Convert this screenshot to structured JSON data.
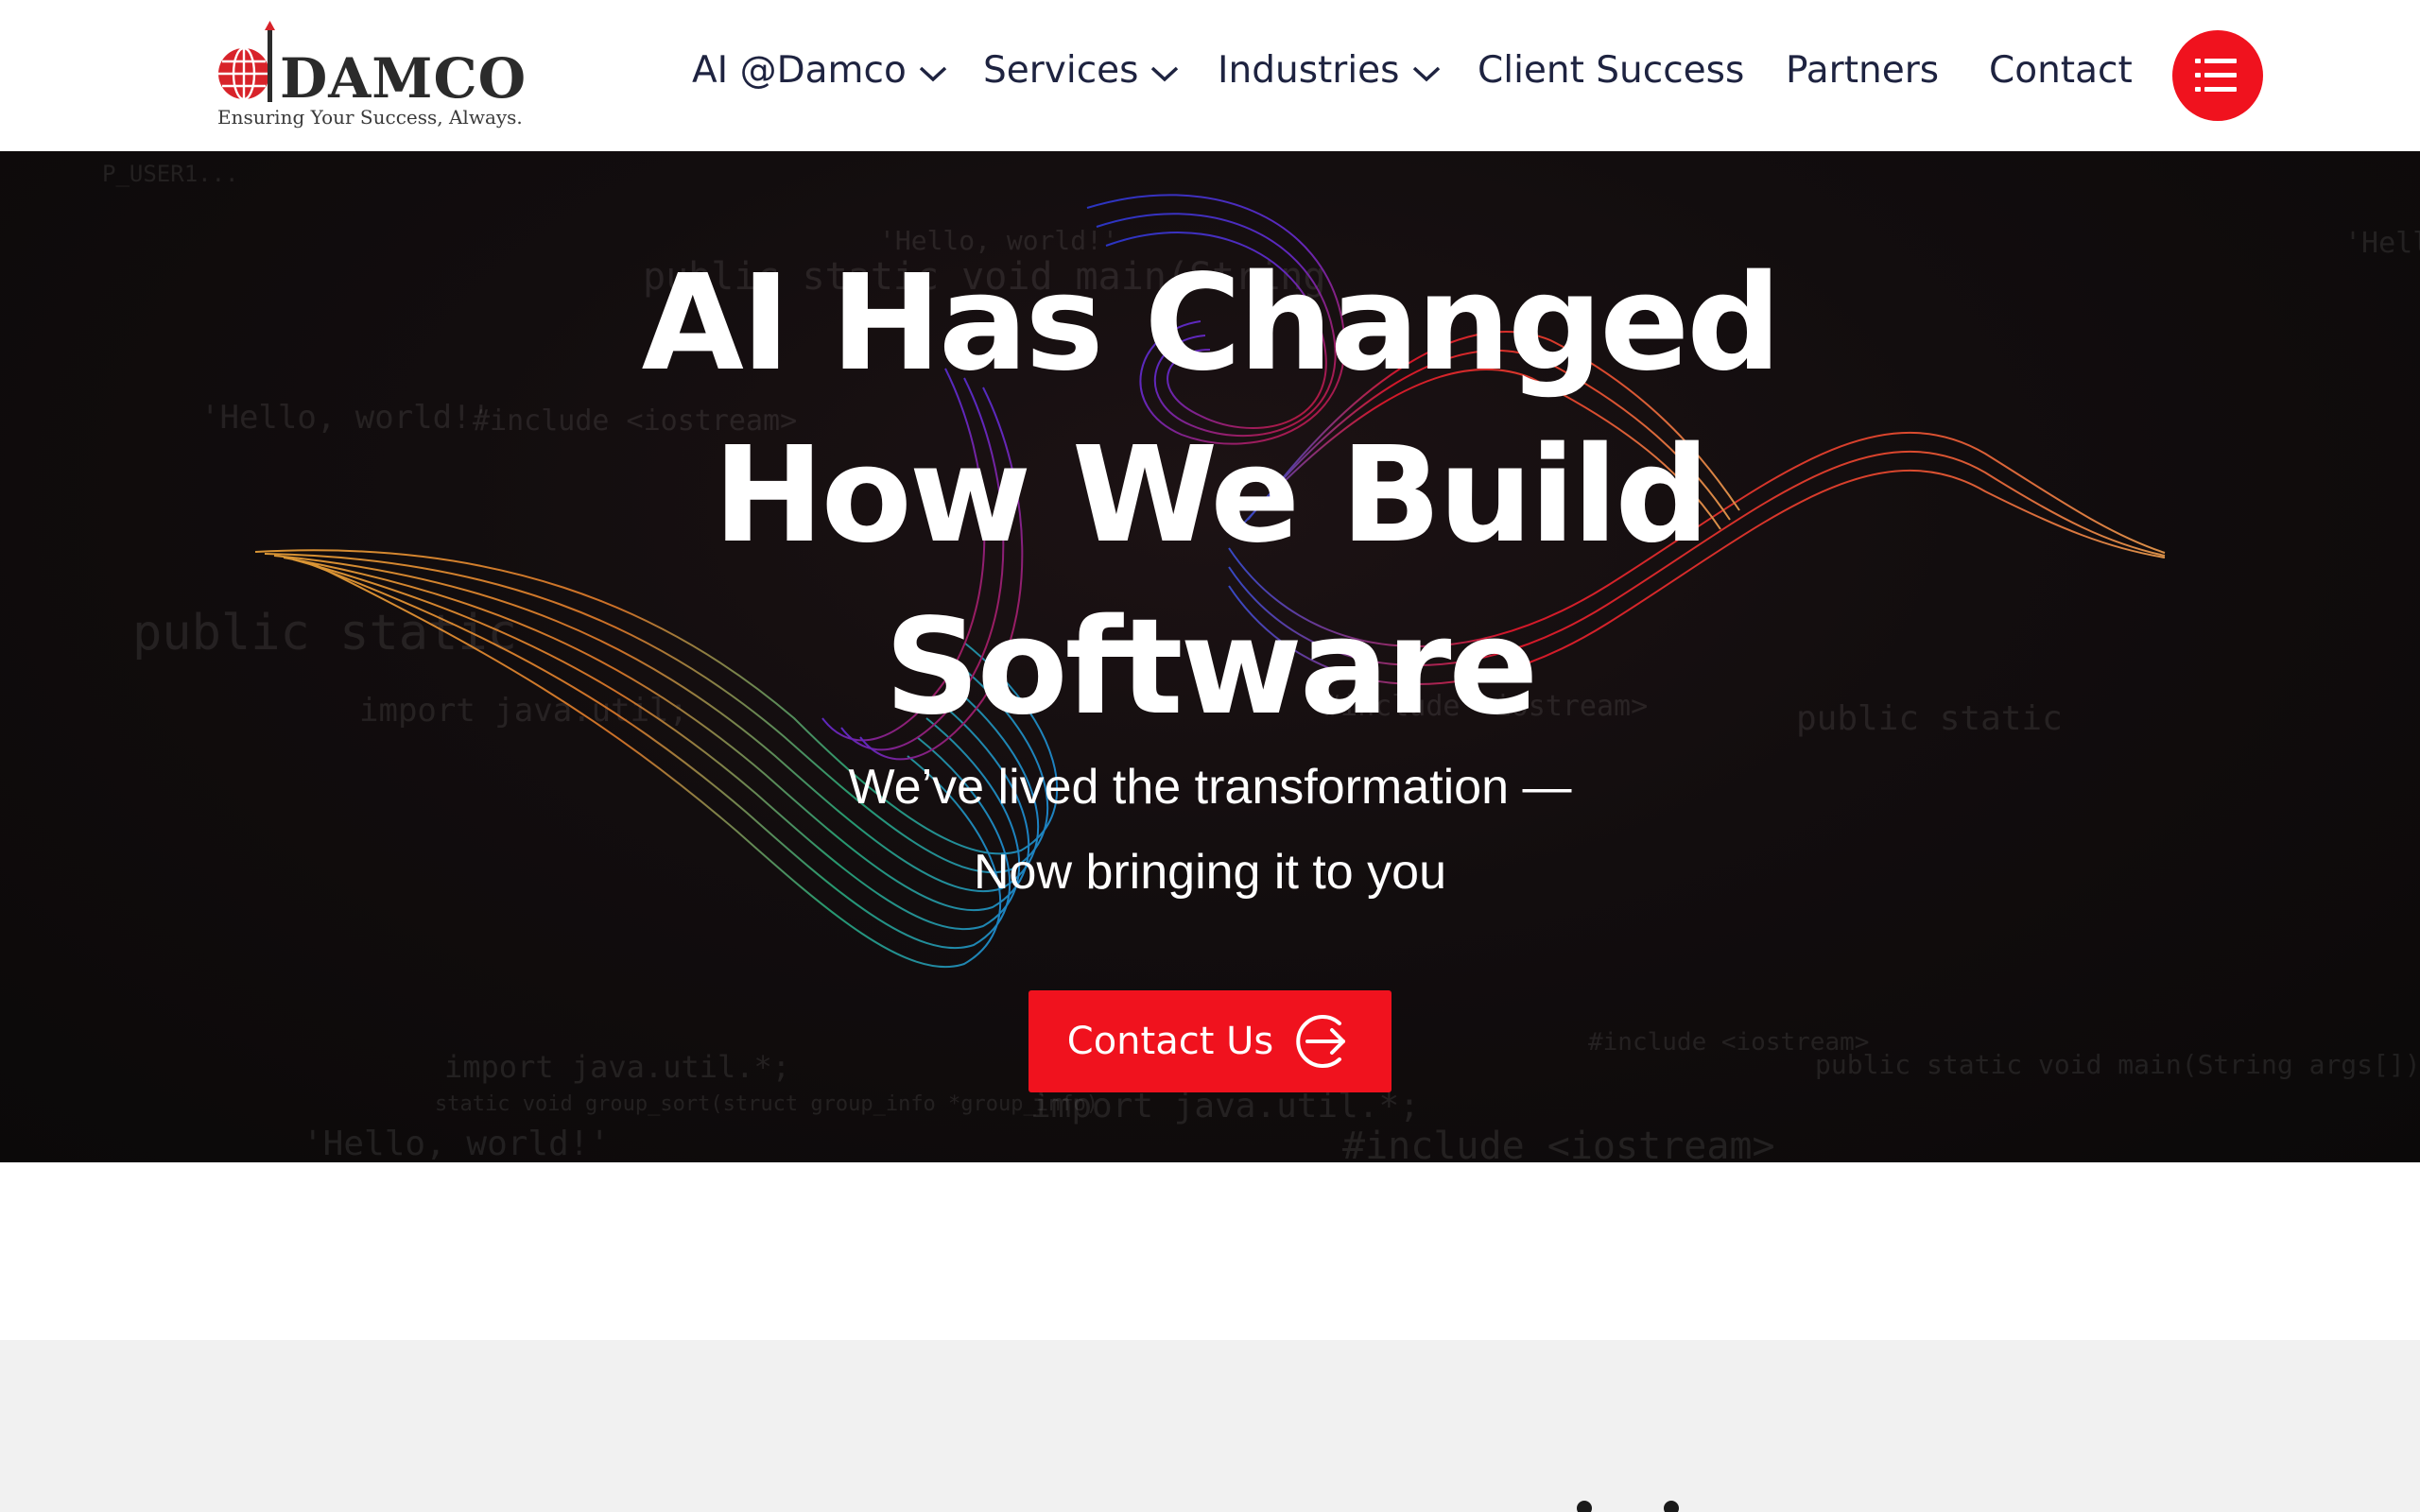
{
  "logo": {
    "wordmark": "DAMCO",
    "tagline": "Ensuring Your Success, Always.",
    "icon": "globe-flag-icon",
    "brand_red": "#d8232a"
  },
  "nav": {
    "items": [
      {
        "label": "AI @Damco",
        "has_dropdown": true
      },
      {
        "label": "Services",
        "has_dropdown": true
      },
      {
        "label": "Industries",
        "has_dropdown": true
      },
      {
        "label": "Client Success",
        "has_dropdown": false
      },
      {
        "label": "Partners",
        "has_dropdown": false
      },
      {
        "label": "Contact",
        "has_dropdown": false
      }
    ],
    "menu_icon": "hamburger-menu-icon",
    "text_color": "#1e2340"
  },
  "hero": {
    "title_lines": [
      "AI Has Changed",
      "How We Build",
      "Software"
    ],
    "subtitle_lines": [
      "We’ve lived the transformation —",
      "Now bringing it to you"
    ],
    "cta_label": "Contact Us",
    "cta_icon": "arrow-right-circle-icon",
    "accent": "#f0121e",
    "background": "#120d0e"
  }
}
